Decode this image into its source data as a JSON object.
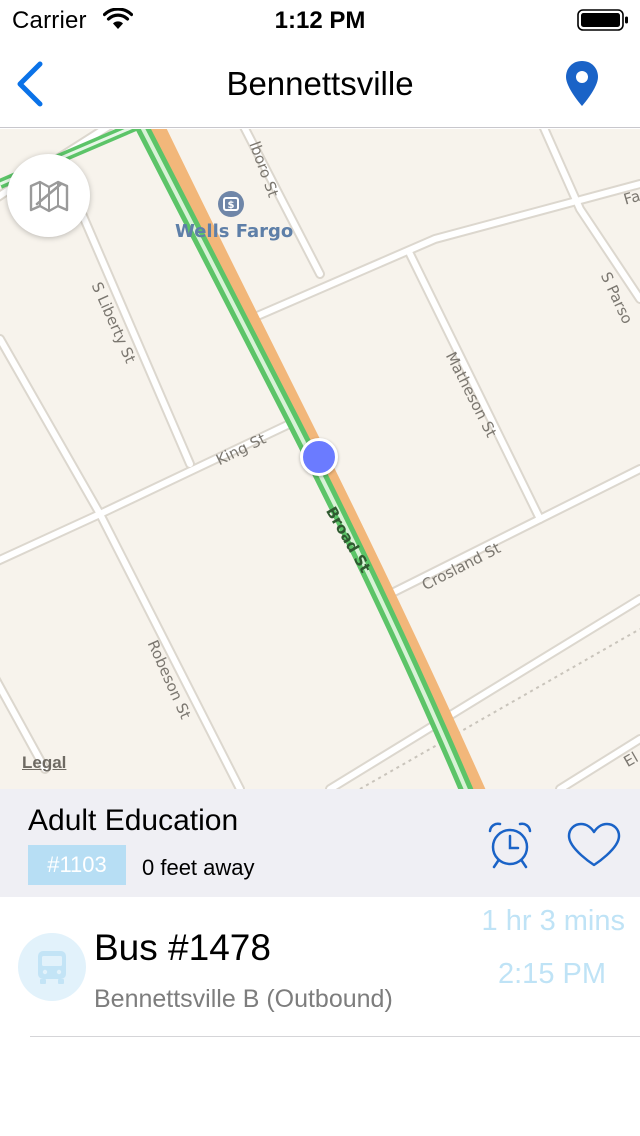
{
  "status_bar": {
    "carrier": "Carrier",
    "time": "1:12 PM",
    "icons": [
      "wifi-icon",
      "battery-icon"
    ]
  },
  "nav": {
    "title": "Bennettsville",
    "back_icon": "chevron-left-icon",
    "right_icon": "location-pin-icon",
    "accent_color": "#0a72e8"
  },
  "map": {
    "poi": "Wells Fargo",
    "streets": [
      "S Liberty St",
      "King St",
      "Robeson St",
      "Matheson St",
      "Crosland St",
      "Broad St"
    ],
    "partial_streets": [
      "lboro St",
      "S Parso",
      "Fa",
      "El"
    ],
    "legal": "Legal",
    "toggle_icon": "map-icon"
  },
  "stop": {
    "name": "Adult Education",
    "badge": "#1103",
    "distance": "0 feet away",
    "icons": [
      "alarm-clock-icon",
      "heart-icon"
    ]
  },
  "arrivals": [
    {
      "title": "Bus #1478",
      "route": "Bennettsville B (Outbound)",
      "eta_relative": "1 hr 3 mins",
      "eta_time": "2:15 PM",
      "icon": "bus-icon"
    }
  ]
}
